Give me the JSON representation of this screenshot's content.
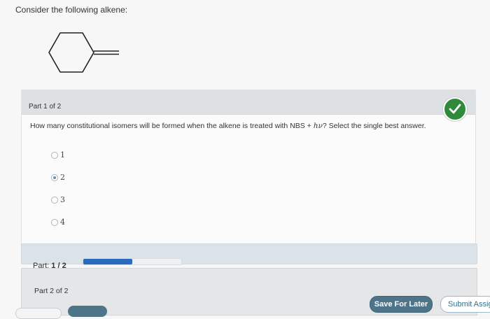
{
  "prompt": "Consider the following alkene:",
  "part1": {
    "header": "Part 1 of 2",
    "status": "correct",
    "question_before": "How many constitutional isomers will be formed when the alkene is treated with NBS + ",
    "question_hv": "hν",
    "question_after": "? Select the single best answer.",
    "options": [
      "1",
      "2",
      "3",
      "4"
    ],
    "selected_index": 1
  },
  "progress": {
    "label": "Part:",
    "value": "1 / 2",
    "fraction": 0.5
  },
  "part2": {
    "header": "Part 2 of 2"
  },
  "buttons": {
    "save": "Save For Later",
    "submit": "Submit Assig"
  },
  "colors": {
    "correct_check": "#2f8a3c",
    "progress_fill": "#2a6bbd",
    "save_button": "#4e7489"
  }
}
